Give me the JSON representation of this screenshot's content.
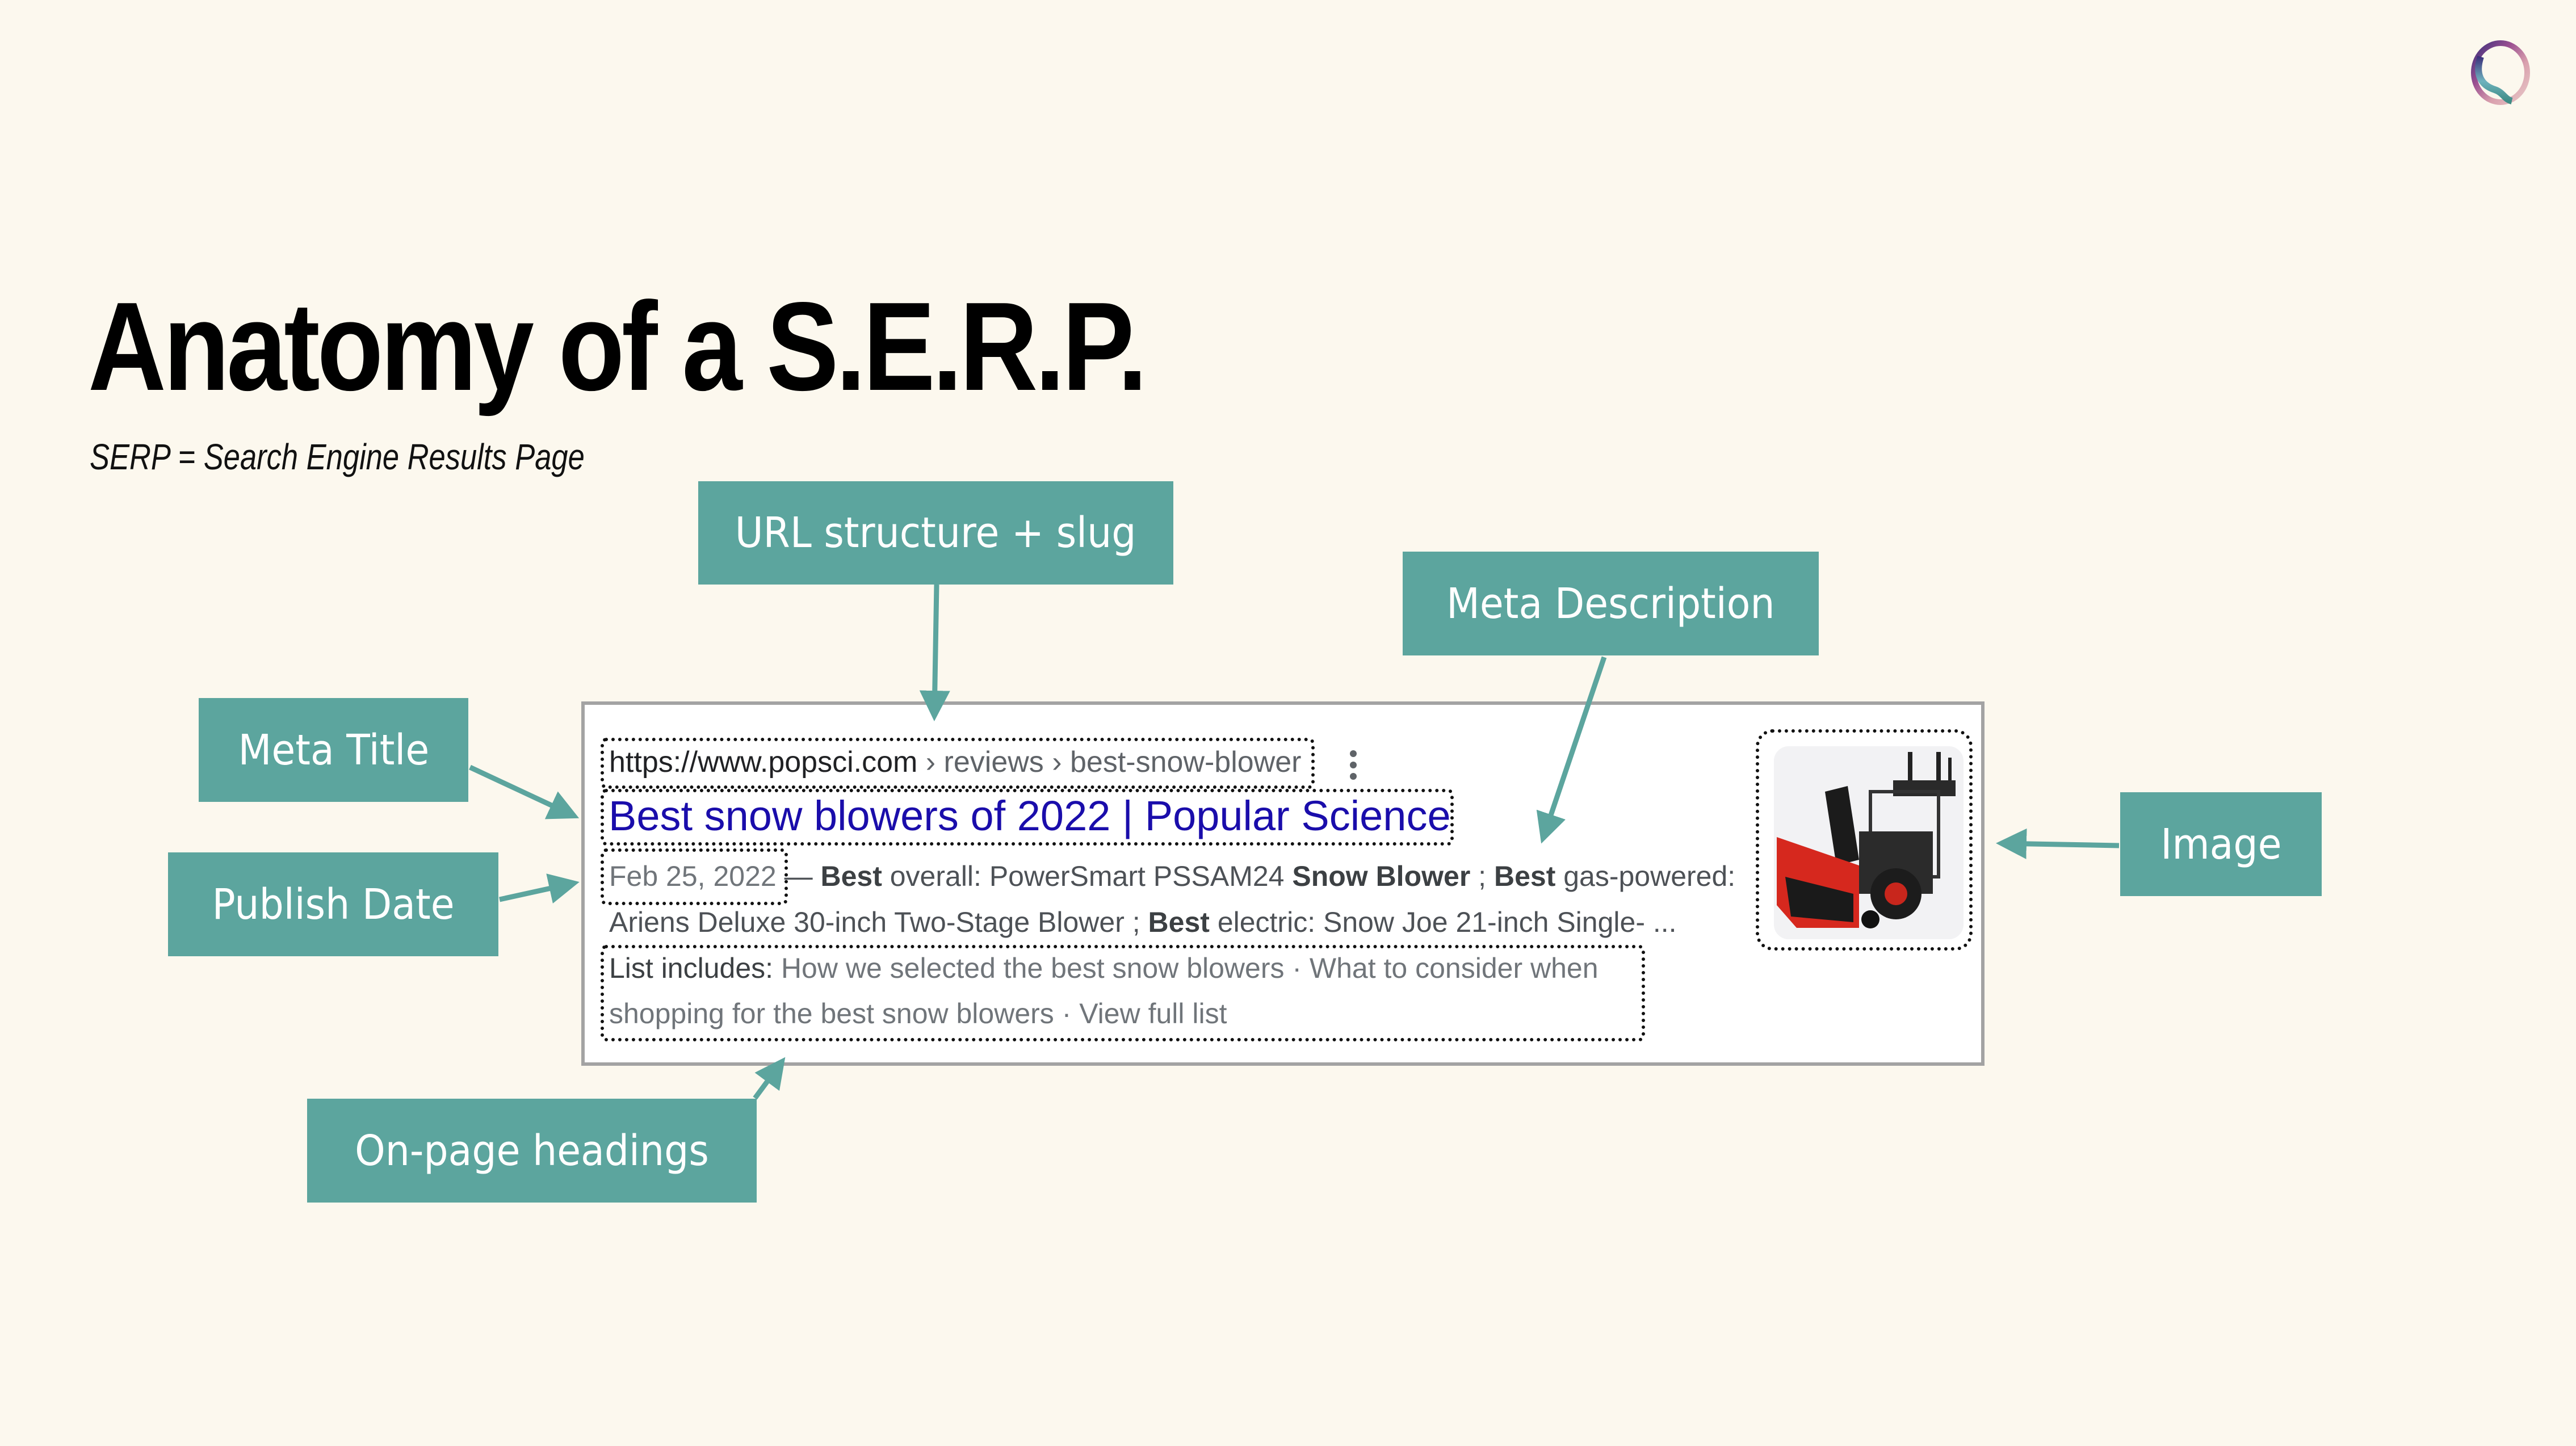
{
  "slide": {
    "title": "Anatomy of a S.E.R.P.",
    "subtitle": "SERP = Search Engine Results Page",
    "accent_color": "#5ca59e",
    "background_color": "#fcf8ee",
    "logo_icon": "gradient-ring-logo-icon"
  },
  "labels": {
    "url": "URL structure + slug",
    "meta_description": "Meta Description",
    "meta_title": "Meta Title",
    "publish_date": "Publish Date",
    "onpage_headings": "On-page headings",
    "image": "Image"
  },
  "serp": {
    "url_base": "https://www.popsci.com",
    "url_crumbs": " › reviews › best-snow-blower",
    "menu_icon": "more-vert-icon",
    "title": "Best snow blowers of 2022 | Popular Science",
    "date": "Feb 25, 2022",
    "desc_line1": [
      {
        "text": " — ",
        "bold": false
      },
      {
        "text": "Best",
        "bold": true
      },
      {
        "text": " overall: PowerSmart PSSAM24 ",
        "bold": false
      },
      {
        "text": "Snow Blower",
        "bold": true
      },
      {
        "text": " ; ",
        "bold": false
      },
      {
        "text": "Best",
        "bold": true
      },
      {
        "text": " gas-powered:",
        "bold": false
      }
    ],
    "desc_line2": [
      {
        "text": "Ariens Deluxe 30-inch Two-Stage Blower ; ",
        "bold": false
      },
      {
        "text": "Best",
        "bold": true
      },
      {
        "text": " electric: Snow Joe 21-inch Single- ...",
        "bold": false
      }
    ],
    "list_label": "List includes:",
    "list_line1": " How we selected the best snow blowers · What to consider when",
    "list_line2": "shopping for the best snow blowers · View full list",
    "thumbnail_alt": "snow blower thumbnail"
  }
}
